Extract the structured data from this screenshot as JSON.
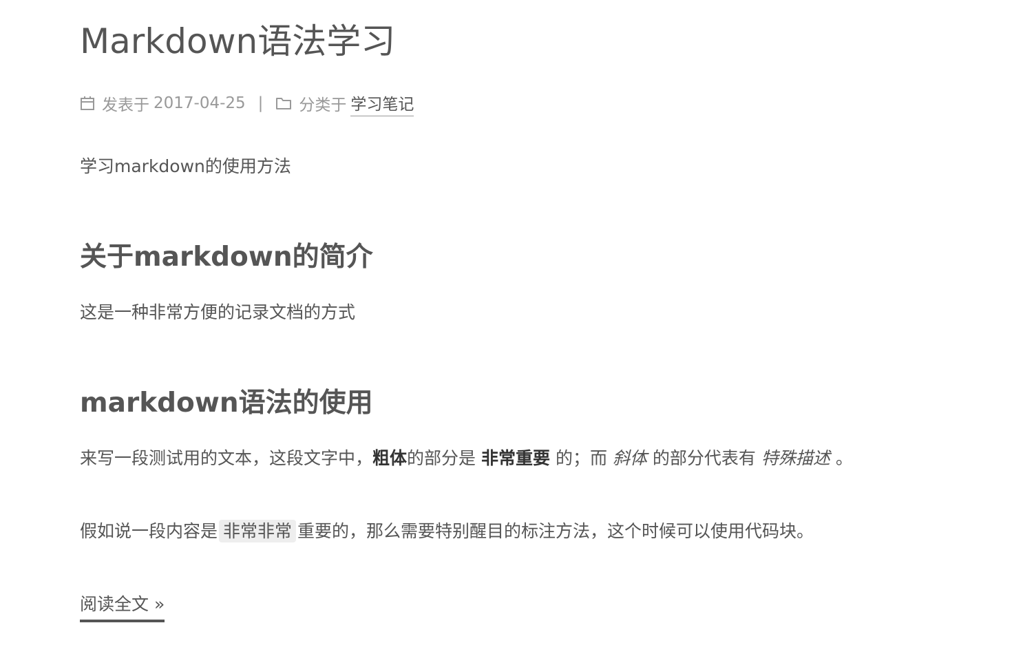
{
  "post": {
    "title": "Markdown语法学习",
    "meta": {
      "posted_label": "发表于",
      "date": "2017-04-25",
      "separator": "|",
      "category_label": "分类于",
      "category": "学习笔记"
    },
    "intro": "学习markdown的使用方法",
    "section1": {
      "heading": "关于markdown的简介",
      "text": "这是一种非常方便的记录文档的方式"
    },
    "section2": {
      "heading": "markdown语法的使用",
      "p1": {
        "a": "来写一段测试用的文本，这段文字中，",
        "bold1": "粗体",
        "b": "的部分是",
        "bold2": "非常重要",
        "c": "的；而",
        "italic1": "斜体",
        "d": "的部分代表有",
        "italic2": "特殊描述",
        "e": "。"
      },
      "p2": {
        "a": "假如说一段内容是",
        "code": "非常非常",
        "b": "重要的，那么需要特别醒目的标注方法，这个时候可以使用代码块。"
      }
    },
    "read_more": "阅读全文 »"
  }
}
